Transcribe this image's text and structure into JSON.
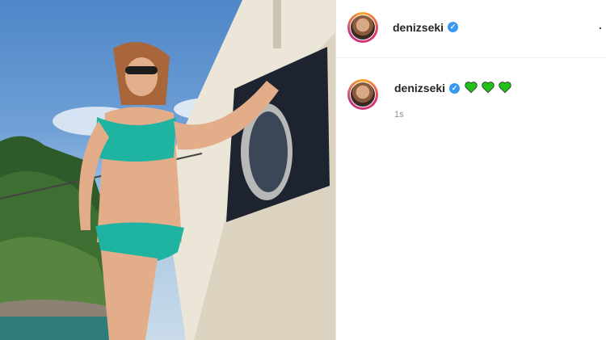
{
  "post": {
    "username": "denizseki",
    "caption_emojis": [
      "💚",
      "💚",
      "💚"
    ],
    "timestamp": "1s"
  },
  "icons": {
    "verified": "verified-badge-icon",
    "more": "more-options-icon",
    "heart": "green-heart-icon"
  },
  "colors": {
    "verified_blue": "#3897f0",
    "heart_green": "#22c21a",
    "username_text": "#262626",
    "timestamp_text": "#8e8e8e"
  }
}
